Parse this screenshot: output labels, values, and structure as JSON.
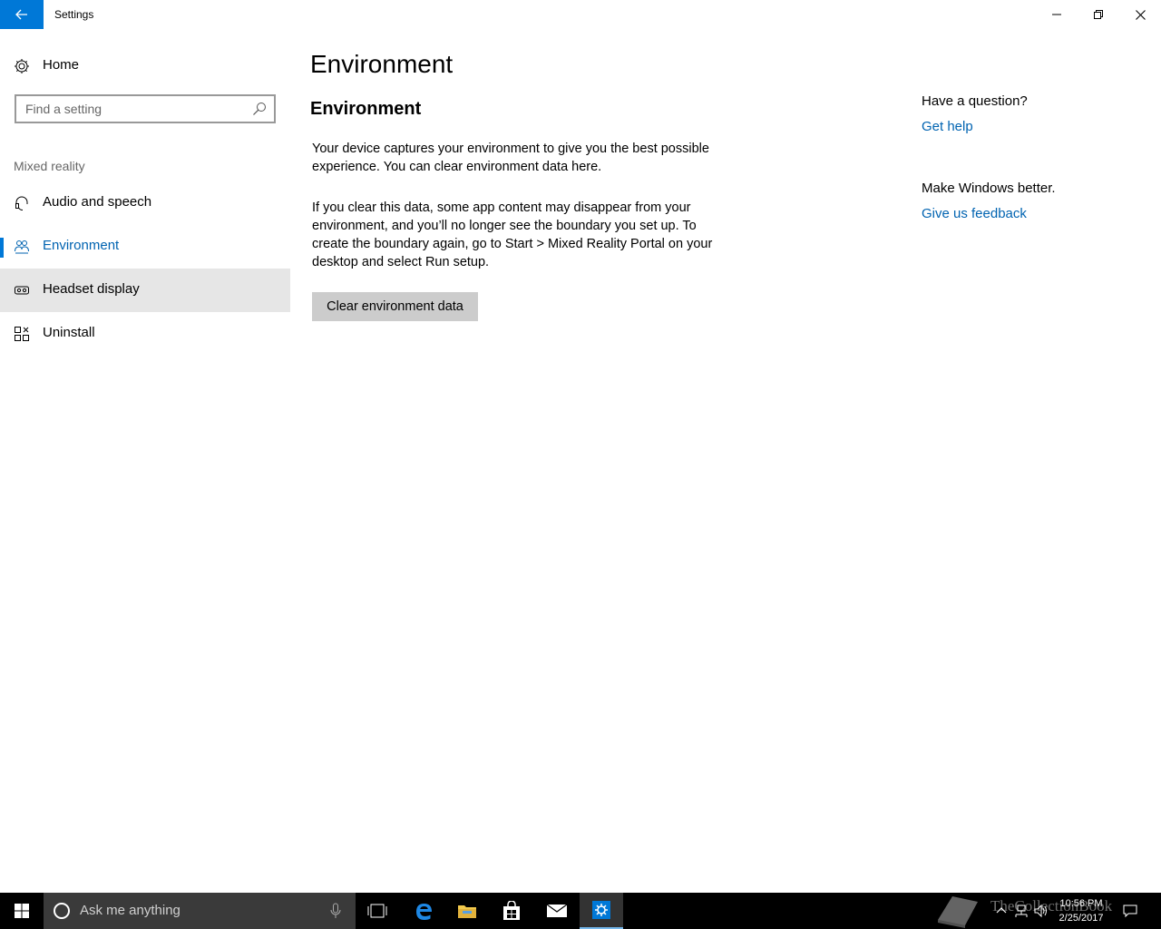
{
  "window": {
    "title": "Settings"
  },
  "sidebar": {
    "home_label": "Home",
    "search_placeholder": "Find a setting",
    "section_header": "Mixed reality",
    "items": [
      {
        "label": "Audio and speech",
        "icon": "headset-icon"
      },
      {
        "label": "Environment",
        "icon": "environment-icon",
        "selected": true
      },
      {
        "label": "Headset display",
        "icon": "headset-display-icon"
      },
      {
        "label": "Uninstall",
        "icon": "uninstall-icon"
      }
    ]
  },
  "main": {
    "page_title": "Environment",
    "section_title": "Environment",
    "paragraph1": "Your device captures your environment to give you the best possible experience. You can clear environment data here.",
    "paragraph2": "If you clear this data, some app content may disappear from your environment, and you’ll no longer see the boundary you set up. To create the boundary again, go to Start > Mixed Reality Portal on your desktop and select Run setup.",
    "clear_button_label": "Clear environment data"
  },
  "related": {
    "question_heading": "Have a question?",
    "get_help_link": "Get help",
    "feedback_heading": "Make Windows better.",
    "feedback_link": "Give us feedback"
  },
  "taskbar": {
    "search_text": "Ask me anything",
    "time": "10:56 PM",
    "date": "2/25/2017",
    "watermark": "TheCollectionBook"
  },
  "colors": {
    "accent": "#0078d7",
    "link": "#0063b1",
    "taskbar": "#000000",
    "hover": "#e6e6e6"
  }
}
